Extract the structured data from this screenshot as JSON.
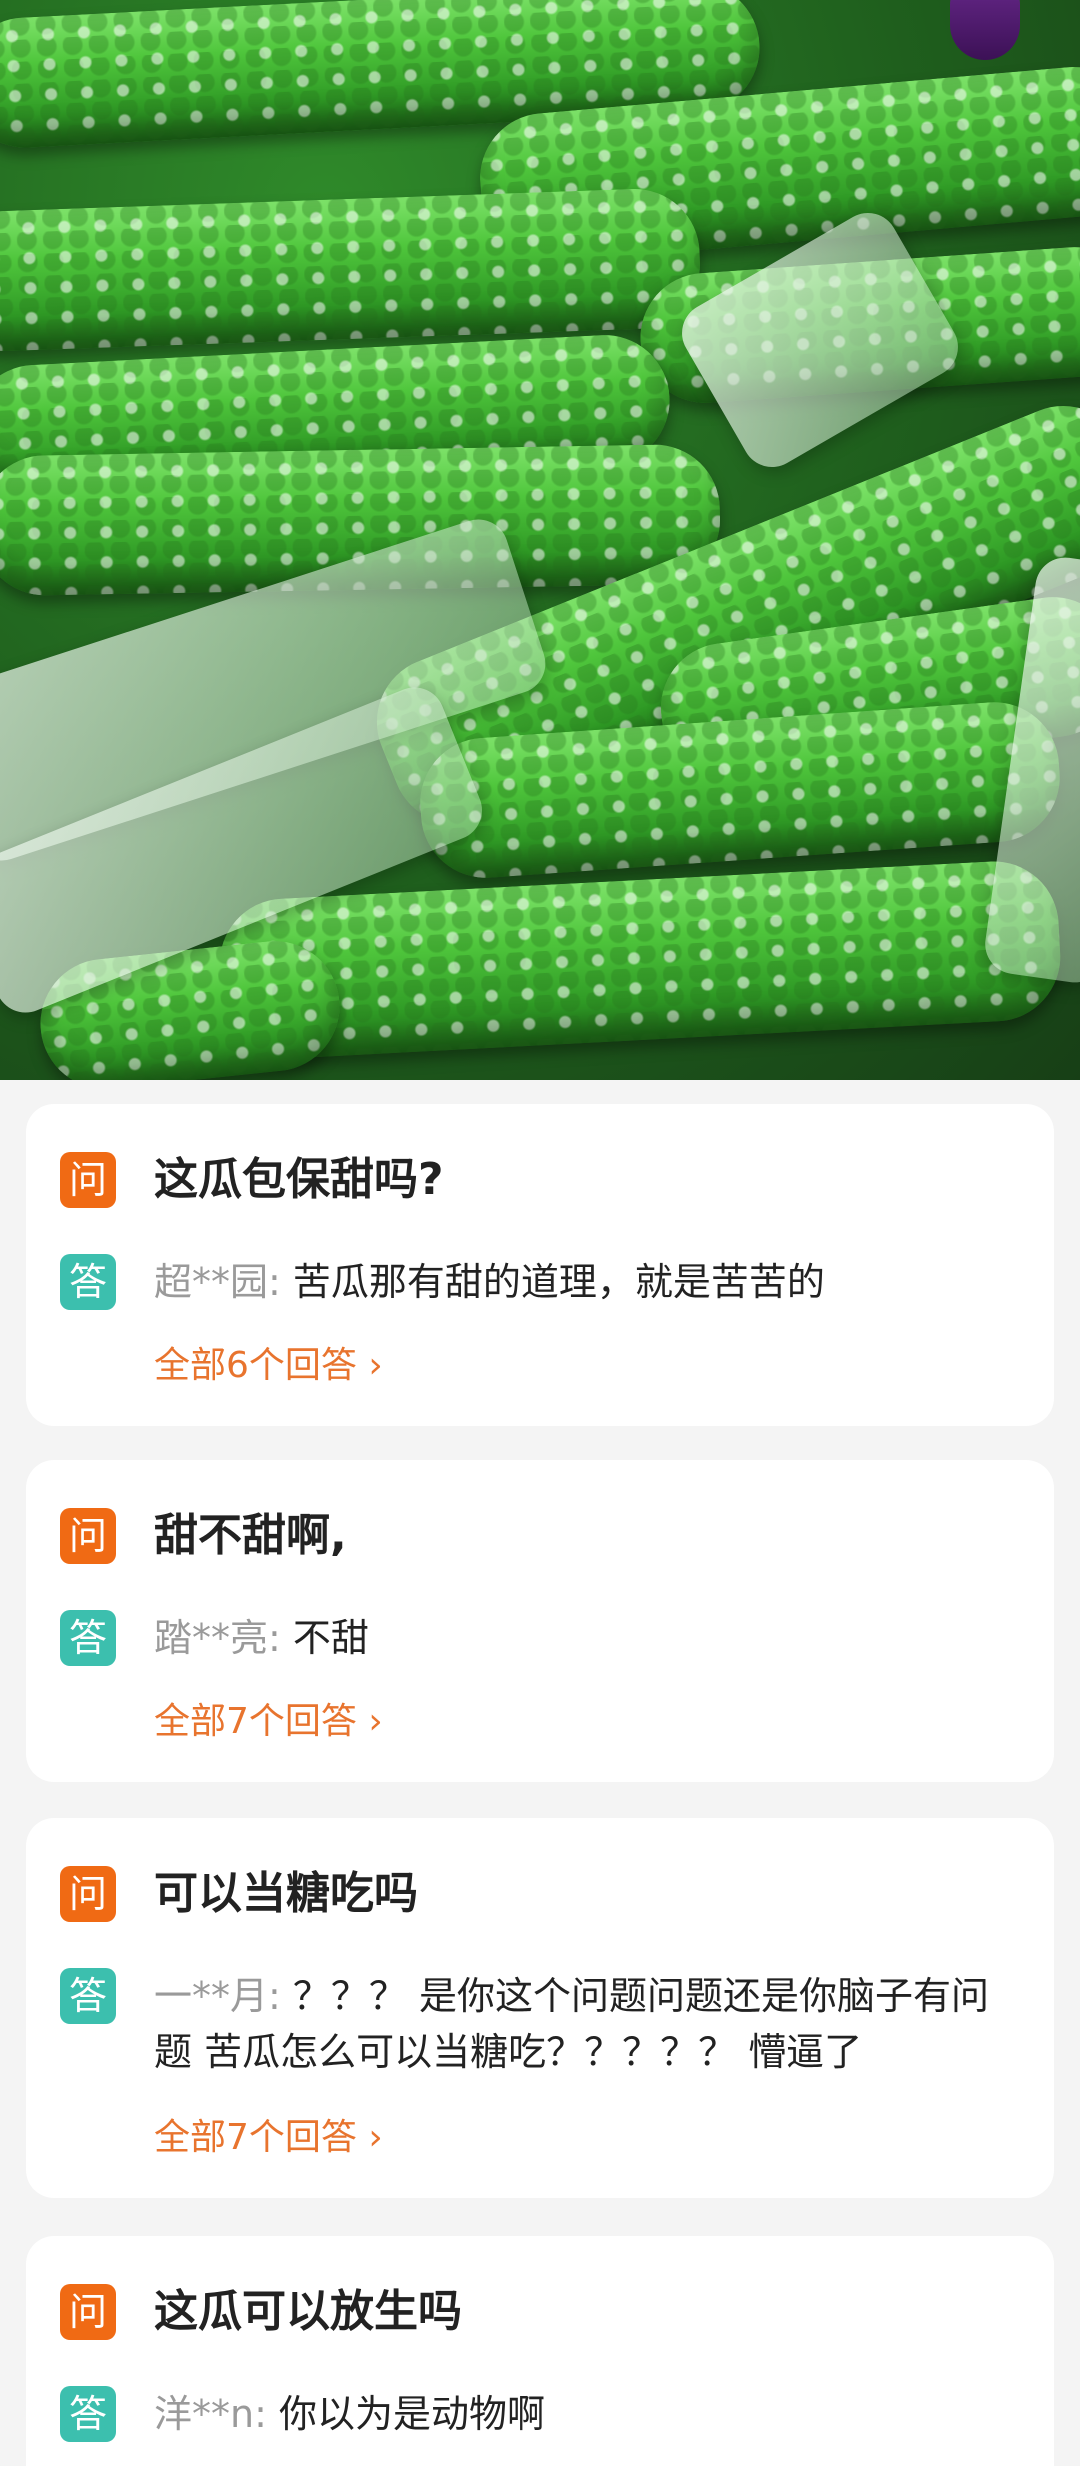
{
  "hero": {
    "icon": "bitter-melon-photo"
  },
  "qa": [
    {
      "q_badge": "问",
      "question": "这瓜包保甜吗?",
      "a_badge": "答",
      "user": "超**园:",
      "answer": " 苦瓜那有甜的道理，就是苦苦的",
      "more": "全部6个回答 ›"
    },
    {
      "q_badge": "问",
      "question": "甜不甜啊,",
      "a_badge": "答",
      "user": "踏**亮:",
      "answer": " 不甜",
      "more": "全部7个回答 ›"
    },
    {
      "q_badge": "问",
      "question": "可以当糖吃吗",
      "a_badge": "答",
      "user": "一**月:",
      "answer": " ？？？ 是你这个问题问题还是你脑子有问题 苦瓜怎么可以当糖吃？？？？？ 懵逼了",
      "more": "全部7个回答 ›"
    },
    {
      "q_badge": "问",
      "question": "这瓜可以放生吗",
      "a_badge": "答",
      "user": "洋**n:",
      "answer": " 你以为是动物啊"
    }
  ],
  "colors": {
    "question_badge": "#f06a14",
    "answer_badge": "#3cbfae",
    "more_link": "#e8742e",
    "page_bg": "#f4f4f4"
  }
}
